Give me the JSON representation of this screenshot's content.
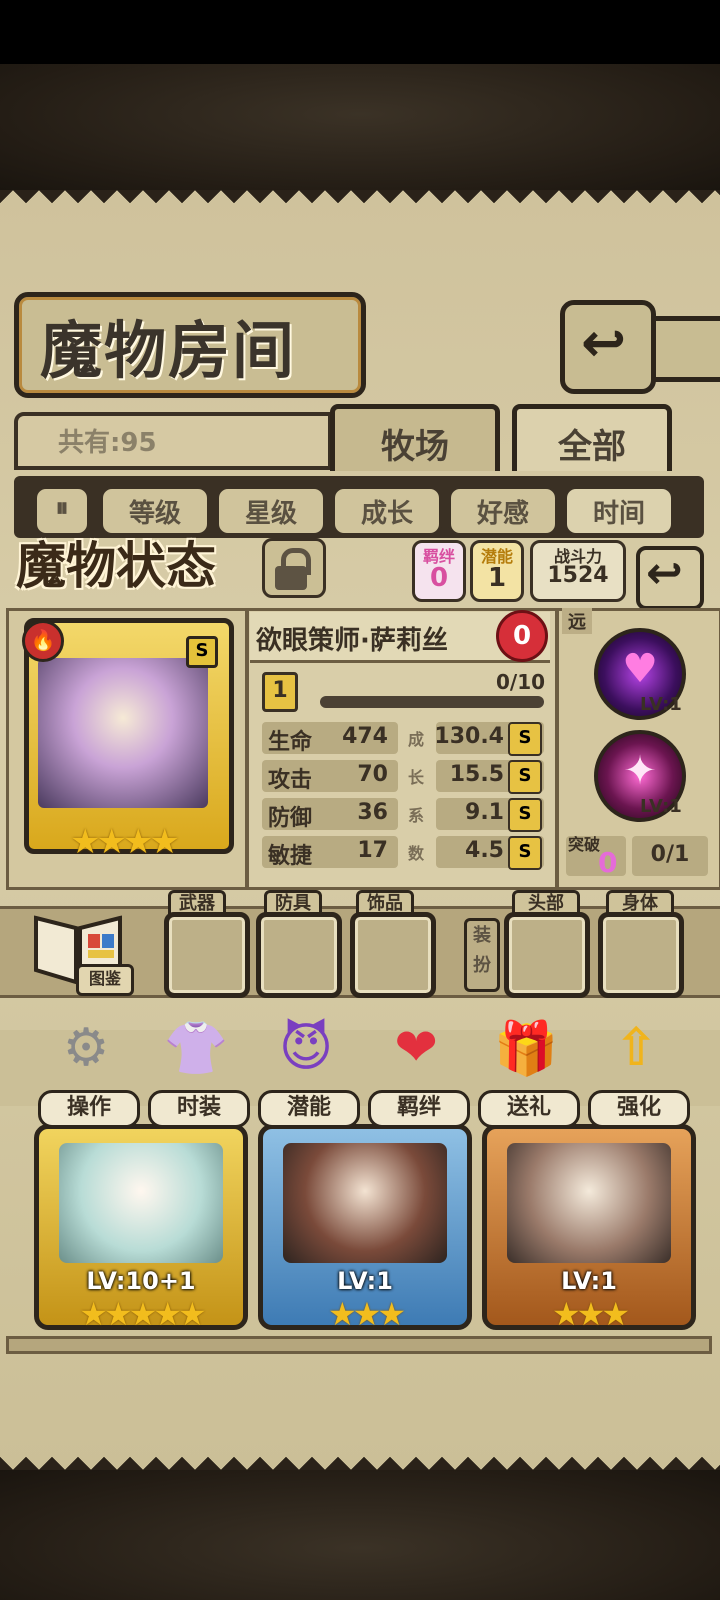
{
  "header": {
    "title": "魔物房间",
    "back_icon": "↩"
  },
  "list": {
    "total_label": "共有:95"
  },
  "tabs": [
    {
      "label": "牧场"
    },
    {
      "label": "全部",
      "active": true
    }
  ],
  "sort": {
    "toggle_icon": "⏸",
    "chips": [
      {
        "label": "等级"
      },
      {
        "label": "星级"
      },
      {
        "label": "成长"
      },
      {
        "label": "好感"
      },
      {
        "label": "时间",
        "active": true
      }
    ]
  },
  "status": {
    "title": "魔物状态",
    "bond": {
      "label": "羁绊",
      "value": "0"
    },
    "potential": {
      "label": "潜能",
      "value": "1"
    },
    "power": {
      "label": "战斗力",
      "value": "1524"
    }
  },
  "monster": {
    "name": "欲眼策师·萨莉丝",
    "affection": "0",
    "rank": "S",
    "element_icon": "fire",
    "stars": "★★★★",
    "level": "1",
    "exp": "0/10",
    "stats": [
      {
        "label": "生命",
        "value": "474",
        "growth": "130.4",
        "grade": "S"
      },
      {
        "label": "攻击",
        "value": "70",
        "growth": "15.5",
        "grade": "S"
      },
      {
        "label": "防御",
        "value": "36",
        "growth": "9.1",
        "grade": "S"
      },
      {
        "label": "敏捷",
        "value": "17",
        "growth": "4.5",
        "grade": "S"
      }
    ],
    "growth_caption": [
      "成",
      "长",
      "系",
      "数"
    ]
  },
  "skills": {
    "range_tag": "远",
    "items": [
      {
        "icon": "♥",
        "level": "LV:1"
      },
      {
        "icon": "✦",
        "level": "LV:1"
      }
    ],
    "break_label": "突破",
    "break_value": "0",
    "break_progress": "0/1"
  },
  "equipment": {
    "codex_label": "图鉴",
    "slots": [
      {
        "label": "武器"
      },
      {
        "label": "防具"
      },
      {
        "label": "饰品"
      },
      {
        "label": "头部"
      },
      {
        "label": "身体"
      }
    ],
    "dress_label": "装扮"
  },
  "actions": [
    {
      "label": "操作",
      "icon": "⚙"
    },
    {
      "label": "时装",
      "icon": "👚"
    },
    {
      "label": "潜能",
      "icon": "😈"
    },
    {
      "label": "羁绊",
      "icon": "❤"
    },
    {
      "label": "送礼",
      "icon": "🎁"
    },
    {
      "label": "强化",
      "icon": "⇧"
    }
  ],
  "roster": [
    {
      "level": "LV:10+1",
      "stars": "★★★★★"
    },
    {
      "level": "LV:1",
      "stars": "★★★"
    },
    {
      "level": "LV:1",
      "stars": "★★★"
    }
  ],
  "colors": {
    "parchment": "#d8cda8",
    "ink": "#2d251b",
    "gold": "#e7c243",
    "heart": "#d62f39",
    "pink": "#e56bd8"
  }
}
